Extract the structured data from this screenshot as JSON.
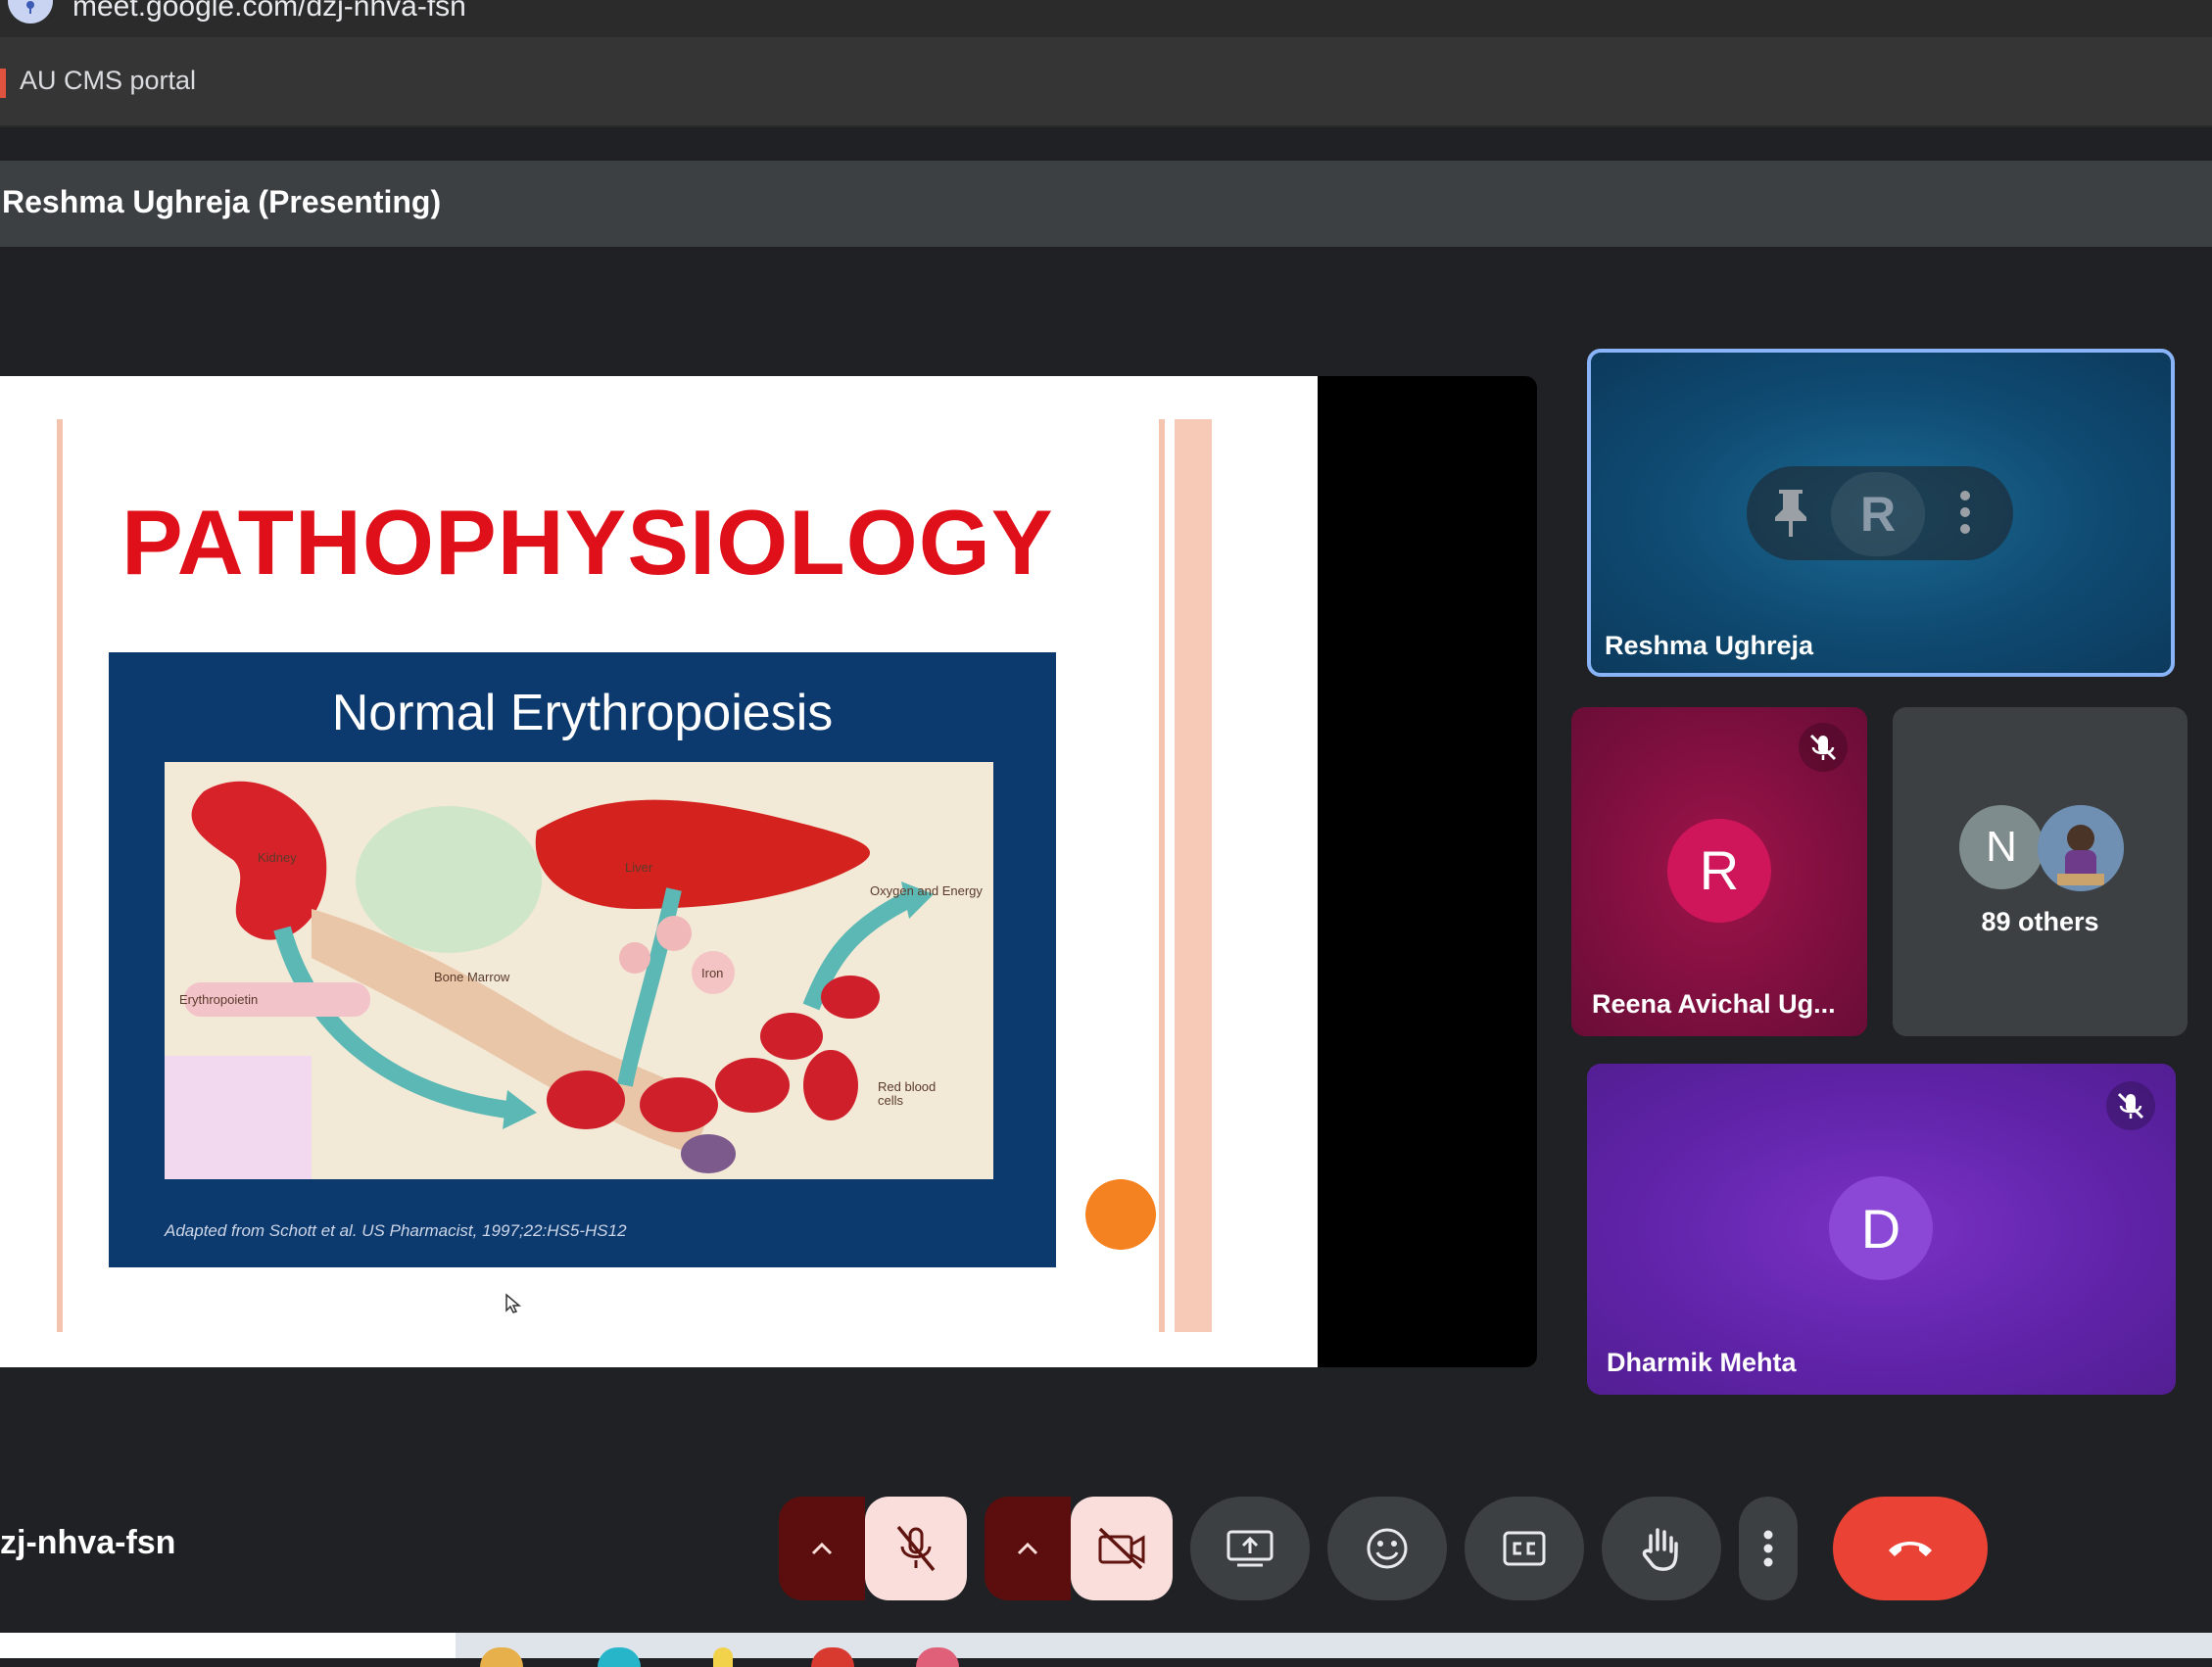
{
  "browser": {
    "url": "meet.google.com/dzj-nhva-fsn",
    "bookmarks": [
      {
        "label": "AU CMS portal"
      }
    ]
  },
  "presenting_bar": {
    "label": "Reshma Ughreja (Presenting)"
  },
  "slide": {
    "title": "PATHOPHYSIOLOGY",
    "subtitle": "Normal Erythropoiesis",
    "figure_labels": [
      "Kidney",
      "Liver",
      "Oxygen and Energy",
      "Bone Marrow",
      "Iron",
      "Erythropoietin",
      "Red blood cells"
    ],
    "citation": "Adapted from Schott et al. US Pharmacist, 1997;22:HS5-HS12",
    "accent_color": "#e0101a"
  },
  "participants": {
    "pinned": {
      "name": "Reshma Ughreja",
      "avatar_letter": "R"
    },
    "tiles": [
      {
        "name": "Reena Avichal Ug...",
        "avatar_letter": "R",
        "muted": true,
        "color": "#d0165a"
      },
      {
        "others_letter": "N",
        "others_label": "89 others"
      },
      {
        "name": "Dharmik Mehta",
        "avatar_letter": "D",
        "muted": true,
        "color": "#8b48d6"
      }
    ]
  },
  "meeting": {
    "code": "zj-nhva-fsn"
  },
  "controls": {
    "mic": {
      "state": "muted",
      "icon": "mic-off-icon"
    },
    "camera": {
      "state": "off",
      "icon": "videocam-off-icon"
    },
    "present": {
      "icon": "present-screen-icon"
    },
    "reactions": {
      "icon": "emoji-icon"
    },
    "captions": {
      "icon": "closed-captions-icon"
    },
    "raise_hand": {
      "icon": "hand-icon"
    },
    "more": {
      "icon": "more-vert-icon"
    },
    "leave": {
      "icon": "call-end-icon",
      "color": "#ea4335"
    }
  }
}
